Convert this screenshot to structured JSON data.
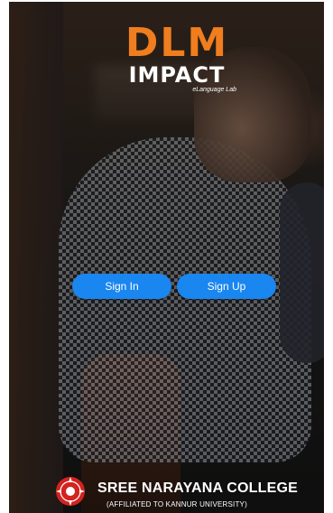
{
  "app": {
    "logo_main": "DLM",
    "logo_secondary": "IMPACT",
    "logo_tagline": "eLanguage Lab"
  },
  "actions": {
    "sign_in_label": "Sign In",
    "sign_up_label": "Sign Up"
  },
  "footer": {
    "college_name": "SREE NARAYANA COLLEGE",
    "college_affiliation": "(AFFILIATED TO KANNUR UNIVERSITY)",
    "emblem_icon": "college-emblem-icon"
  },
  "colors": {
    "accent": "#1a86f0",
    "logo_orange": "#f07e1f",
    "emblem_red": "#d2231e"
  }
}
